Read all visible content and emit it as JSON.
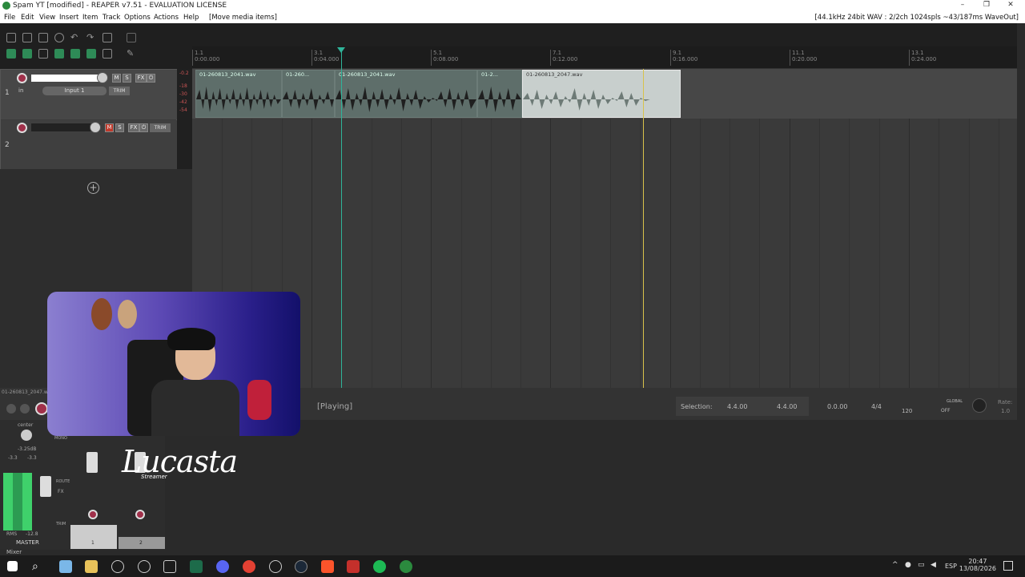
{
  "window": {
    "title": "Spam YT [modified] - REAPER v7.51 - EVALUATION LICENSE",
    "minimize": "–",
    "maximize": "❐",
    "close": "✕"
  },
  "menu": {
    "items": [
      "File",
      "Edit",
      "View",
      "Insert",
      "Item",
      "Track",
      "Options",
      "Actions",
      "Help"
    ],
    "mode": "[Move media items]",
    "status": "[44.1kHz 24bit WAV : 2/2ch 1024spls ~43/187ms WaveOut]"
  },
  "ruler": {
    "marks": [
      {
        "bar": "1.1",
        "time": "0:00.000"
      },
      {
        "bar": "3.1",
        "time": "0:04.000"
      },
      {
        "bar": "5.1",
        "time": "0:08.000"
      },
      {
        "bar": "7.1",
        "time": "0:12.000"
      },
      {
        "bar": "9.1",
        "time": "0:16.000"
      },
      {
        "bar": "11.1",
        "time": "0:20.000"
      },
      {
        "bar": "13.1",
        "time": "0:24.000"
      }
    ]
  },
  "tracks": [
    {
      "number": "1",
      "input": "Input 1",
      "mute": "M",
      "solo": "S",
      "fx": "FX",
      "trim": "TRIM",
      "in": "in"
    },
    {
      "number": "2",
      "mute": "M",
      "solo": "S",
      "fx": "FX",
      "trim": "TRIM"
    }
  ],
  "clips": [
    {
      "name": "01-260813_2041.wav"
    },
    {
      "name": "01-260..."
    },
    {
      "name": "01-260813_2041.wav"
    },
    {
      "name": "01-2..."
    },
    {
      "name": "01-260813_2047.wav"
    }
  ],
  "add_track": "+",
  "transport": {
    "state": "[Playing]",
    "selection_label": "Selection:",
    "sel_start": "4.4.00",
    "sel_end": "4.4.00",
    "sel_len": "0.0.00",
    "timesig": "4/4",
    "bpm": "120",
    "global": "GLOBAL",
    "global_state": "OFF",
    "rate_label": "Rate:",
    "rate": "1.0",
    "item_name": "01-260813_2047.w"
  },
  "mixer": {
    "pan": "center",
    "db": "-3.25dB",
    "peak_l": "-3.3",
    "peak_r": "-3.3",
    "rms": "RMS",
    "rms_val": "-12.8",
    "master_label": "MASTER",
    "mixer_tab": "Mixer",
    "mono": "MONO",
    "route": "ROUTE",
    "fx": "FX",
    "trim": "TRIM",
    "ch1": "1",
    "ch2": "2",
    "meter_scale": [
      "-0.2",
      "-18",
      "-30",
      "-42",
      "-54"
    ]
  },
  "overlay": {
    "logo": "Lucasta",
    "logo_sub": "Streamer"
  },
  "taskbar": {
    "lang": "ESP",
    "time": "20:47",
    "date": "13/08/2026"
  },
  "colors": {
    "accent_playcursor": "#2fb49a",
    "edit_cursor": "#d8c24a",
    "record_arm": "#a0304a",
    "meter_green": "#3fd16b"
  }
}
